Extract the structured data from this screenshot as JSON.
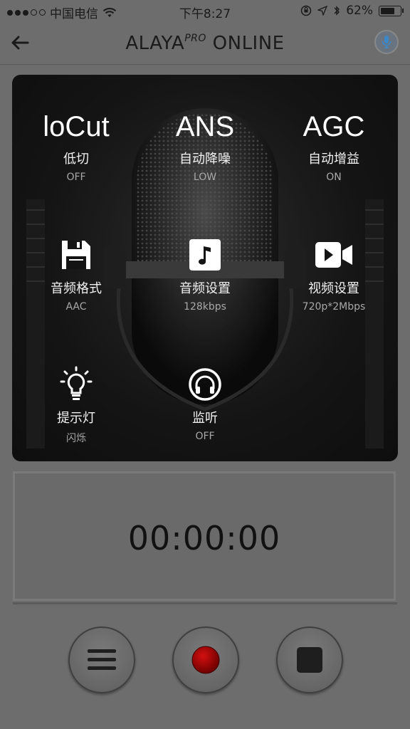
{
  "status_bar": {
    "carrier": "中国电信",
    "time": "下午8:27",
    "battery": "62%",
    "battery_level": 0.62
  },
  "header": {
    "title_main": "ALAYA",
    "title_sup": "PRO",
    "title_tail": " ONLINE"
  },
  "settings": {
    "locut": {
      "big": "loCut",
      "label": "低切",
      "value": "OFF"
    },
    "ans": {
      "big": "ANS",
      "label": "自动降噪",
      "value": "LOW"
    },
    "agc": {
      "big": "AGC",
      "label": "自动增益",
      "value": "ON"
    },
    "audio_format": {
      "label": "音频格式",
      "value": "AAC",
      "icon": "floppy-disk-icon"
    },
    "audio_settings": {
      "label": "音频设置",
      "value": "128kbps",
      "icon": "music-note-icon"
    },
    "video_settings": {
      "label": "视频设置",
      "value": "720p*2Mbps",
      "icon": "video-camera-icon"
    },
    "indicator_light": {
      "label": "提示灯",
      "value": "闪烁",
      "icon": "light-bulb-icon"
    },
    "monitor": {
      "label": "监听",
      "value": "OFF",
      "icon": "headphones-icon"
    }
  },
  "timer": {
    "value": "00:00:00"
  },
  "controls": {
    "menu_icon": "hamburger-menu-icon",
    "record_icon": "record-icon",
    "stop_icon": "stop-icon",
    "record_color": "#b30000"
  }
}
